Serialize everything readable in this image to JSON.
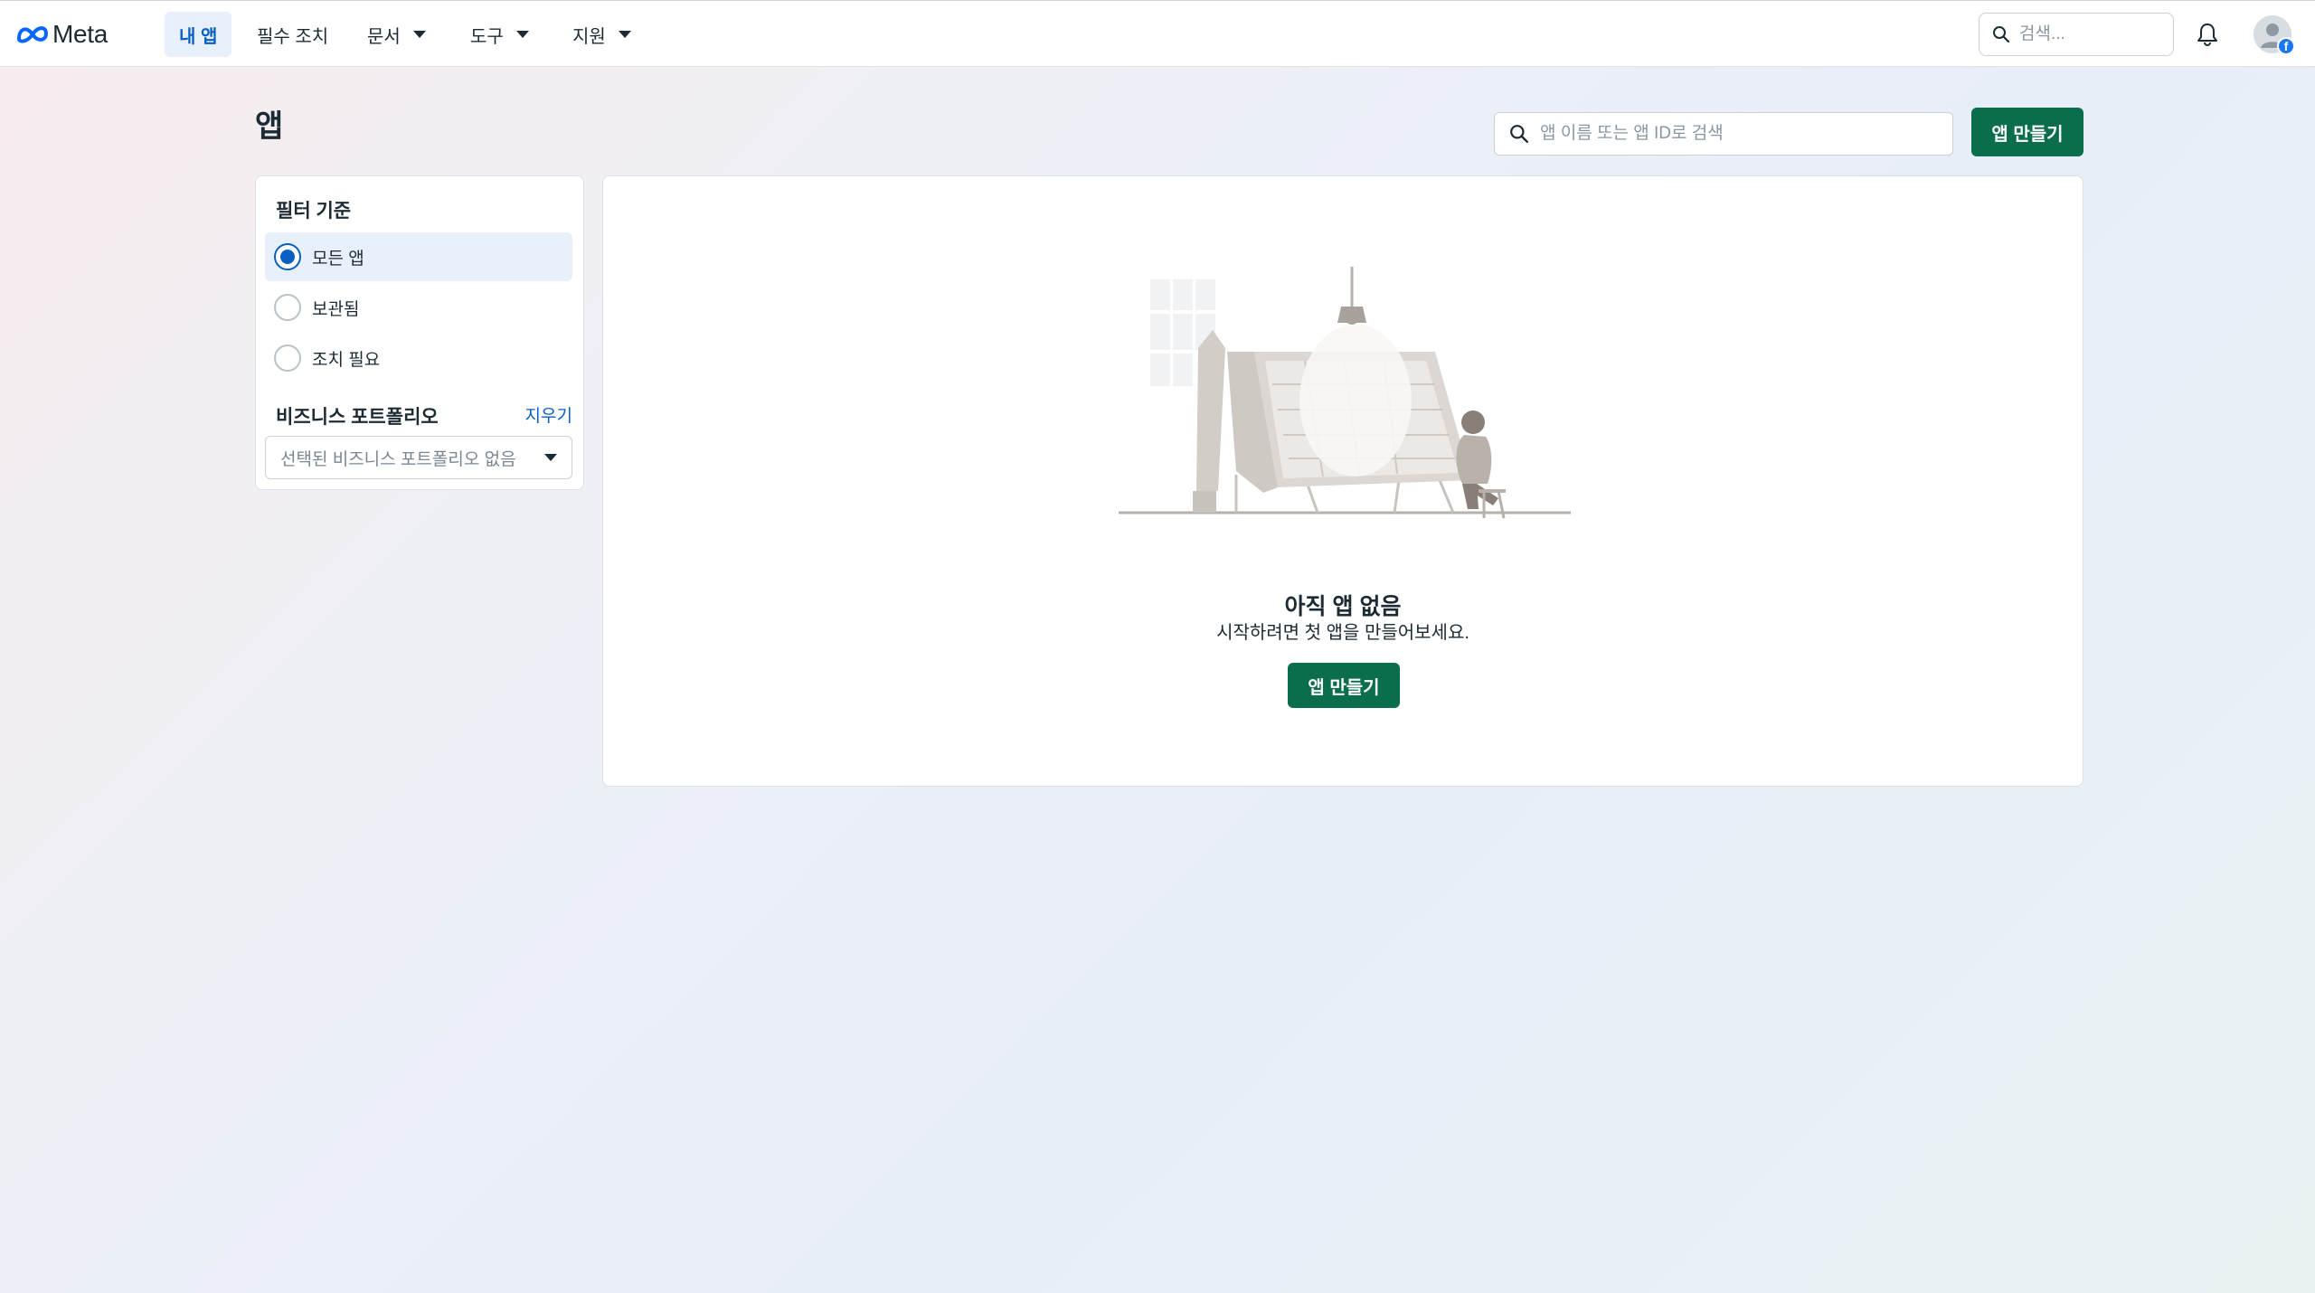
{
  "nav": {
    "brand": "Meta",
    "links": [
      {
        "label": "내 앱",
        "active": true,
        "dropdown": false
      },
      {
        "label": "필수 조치",
        "active": false,
        "dropdown": false
      },
      {
        "label": "문서",
        "active": false,
        "dropdown": true
      },
      {
        "label": "도구",
        "active": false,
        "dropdown": true
      },
      {
        "label": "지원",
        "active": false,
        "dropdown": true
      }
    ],
    "search_placeholder": "검색...",
    "notifications_icon": "bell-icon",
    "avatar_badge": "f"
  },
  "page": {
    "title": "앱",
    "search_placeholder": "앱 이름 또는 앱 ID로 검색",
    "create_button": "앱 만들기"
  },
  "filter": {
    "title": "필터 기준",
    "options": [
      {
        "label": "모든 앱",
        "selected": true
      },
      {
        "label": "보관됨",
        "selected": false
      },
      {
        "label": "조치 필요",
        "selected": false
      }
    ],
    "business_portfolio_title": "비즈니스 포트폴리오",
    "clear_label": "지우기",
    "business_portfolio_select": "선택된 비즈니스 포트폴리오 없음"
  },
  "empty_state": {
    "title": "아직 앱 없음",
    "subtitle": "시작하려면 첫 앱을 만들어보세요.",
    "button": "앱 만들기"
  },
  "colors": {
    "primary_green": "#0a6e4c",
    "accent_blue": "#0a5fc2",
    "selected_bg": "#e7f0fb"
  }
}
